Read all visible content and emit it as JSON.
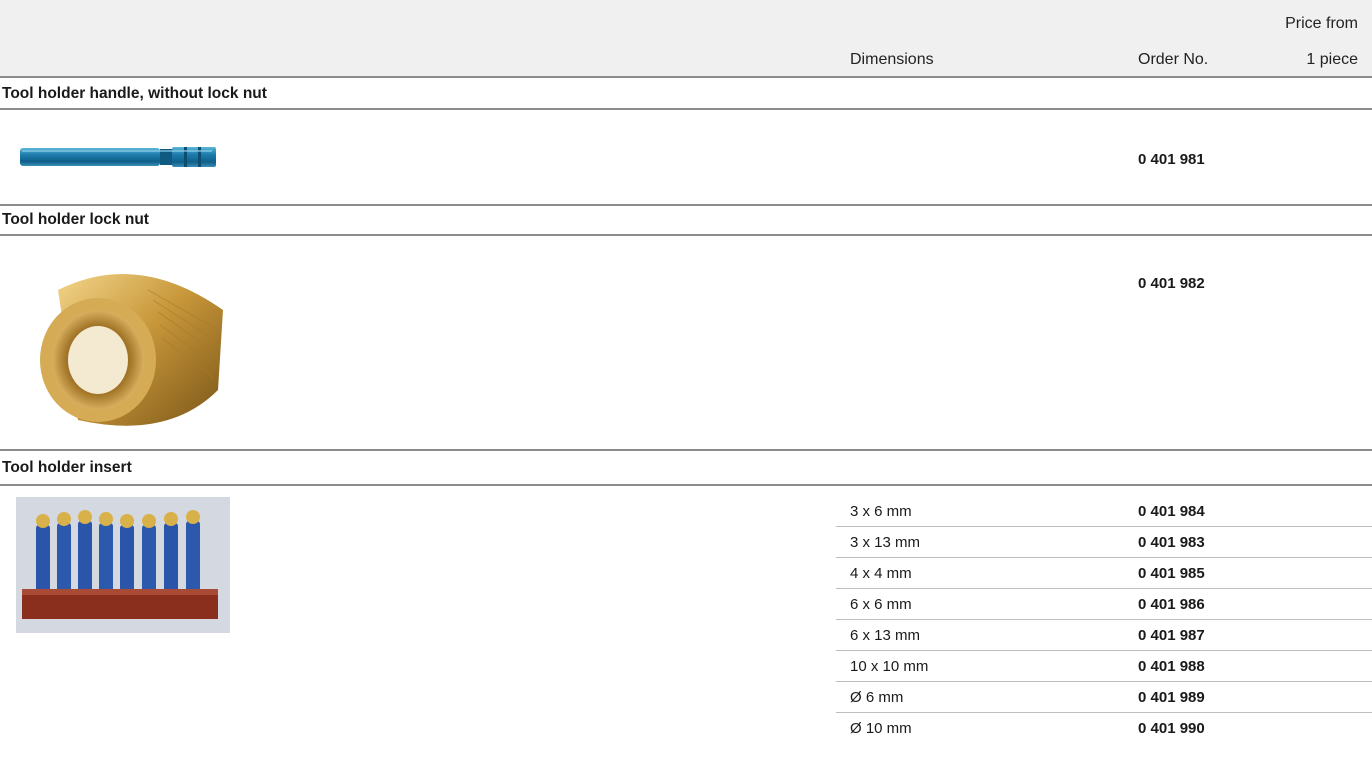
{
  "header": {
    "price_line1": "Price from",
    "price_line2": "1 piece",
    "dimensions": "Dimensions",
    "order_no": "Order No."
  },
  "sections": [
    {
      "title": "Tool holder handle, without lock nut",
      "order_no": "0 401 981",
      "image": "blue-handle-image"
    },
    {
      "title": "Tool holder lock nut",
      "order_no": "0 401 982",
      "image": "brass-lock-nut-image"
    },
    {
      "title": "Tool holder insert",
      "image": "inserts-in-stand-image",
      "rows": [
        {
          "dimensions": "3 x 6 mm",
          "order_no": "0 401 984"
        },
        {
          "dimensions": "3 x 13 mm",
          "order_no": "0 401 983"
        },
        {
          "dimensions": "4 x 4 mm",
          "order_no": "0 401 985"
        },
        {
          "dimensions": "6 x 6 mm",
          "order_no": "0 401 986"
        },
        {
          "dimensions": "6 x 13 mm",
          "order_no": "0 401 987"
        },
        {
          "dimensions": "10 x 10 mm",
          "order_no": "0 401 988"
        },
        {
          "dimensions": "Ø 6 mm",
          "order_no": "0 401 989"
        },
        {
          "dimensions": "Ø 10 mm",
          "order_no": "0 401 990"
        }
      ]
    }
  ]
}
